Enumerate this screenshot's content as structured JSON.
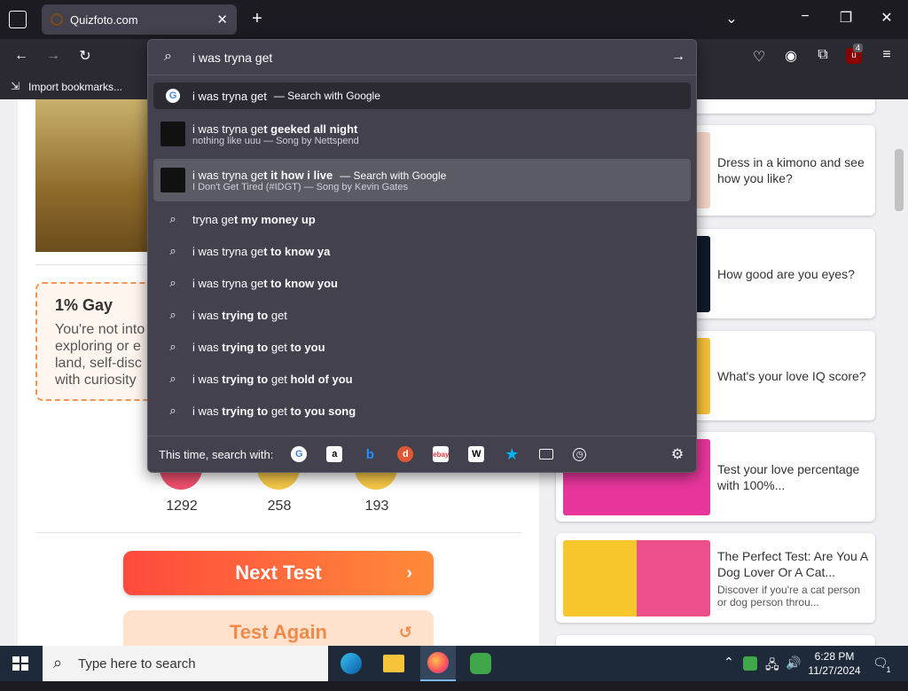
{
  "browser": {
    "tab_title": "Quizfoto.com",
    "bookmarks_label": "Import bookmarks...",
    "ublock_badge": "4"
  },
  "urlbar": {
    "query_typed": "i was tryna get",
    "suggestions": [
      {
        "pre": "i was tryna get",
        "bold": "",
        "post": "— Search with Google",
        "sub": "",
        "kind": "google"
      },
      {
        "pre": "i was tryna ge",
        "bold": "t geeked all night",
        "post": "",
        "sub": "nothing like uuu — Song by Nettspend",
        "kind": "art"
      },
      {
        "pre": "i was tryna ge",
        "bold": "t it how i live",
        "post": "— Search with Google",
        "sub": "I Don't Get Tired (#IDGT) — Song by Kevin Gates",
        "kind": "art"
      },
      {
        "pre": "tryna ge",
        "bold": "t my money up",
        "post": "",
        "sub": "",
        "kind": "search"
      },
      {
        "pre": "i was tryna ge",
        "bold": "t to know ya",
        "post": "",
        "sub": "",
        "kind": "search"
      },
      {
        "pre": "i was tryna ge",
        "bold": "t to know you",
        "post": "",
        "sub": "",
        "kind": "search"
      },
      {
        "pre": "i was ",
        "bold": "trying to",
        "post2": " get",
        "bold2": "",
        "kind": "search2"
      },
      {
        "pre": "i was ",
        "bold": "trying to",
        "post2": " get",
        "bold2": " to you",
        "kind": "search2"
      },
      {
        "pre": "i was ",
        "bold": "trying to",
        "post2": " get",
        "bold2": " hold of you",
        "kind": "search2"
      },
      {
        "pre": "i was ",
        "bold": "trying to",
        "post2": " get",
        "bold2": " to you song",
        "kind": "search2"
      }
    ],
    "search_with_label": "This time, search with:"
  },
  "page": {
    "result_title": "1% Gay",
    "result_text_lines": [
      "You're not into",
      "exploring or e",
      "land, self-disc",
      "with curiosity"
    ],
    "counts": [
      "1292",
      "258",
      "193"
    ],
    "next_button": "Next Test",
    "again_button": "Test Again",
    "cards": [
      {
        "title": "Dress in a kimono and see how you like?",
        "sub": ""
      },
      {
        "title": "How good are you eyes?",
        "sub": ""
      },
      {
        "title": "What's your love IQ score?",
        "sub": ""
      },
      {
        "title": "Test your love percentage with 100%...",
        "sub": ""
      },
      {
        "title": "The Perfect Test: Are You A Dog Lover Or A Cat...",
        "sub": "Discover if you're a cat person or dog person throu..."
      }
    ]
  },
  "taskbar": {
    "search_placeholder": "Type here to search",
    "time": "6:28 PM",
    "date": "11/27/2024",
    "notif_count": "1"
  },
  "colors": {
    "accent": "#ff4a3d",
    "firefox_dark": "#1c1b22",
    "popup_bg": "#42414d"
  }
}
